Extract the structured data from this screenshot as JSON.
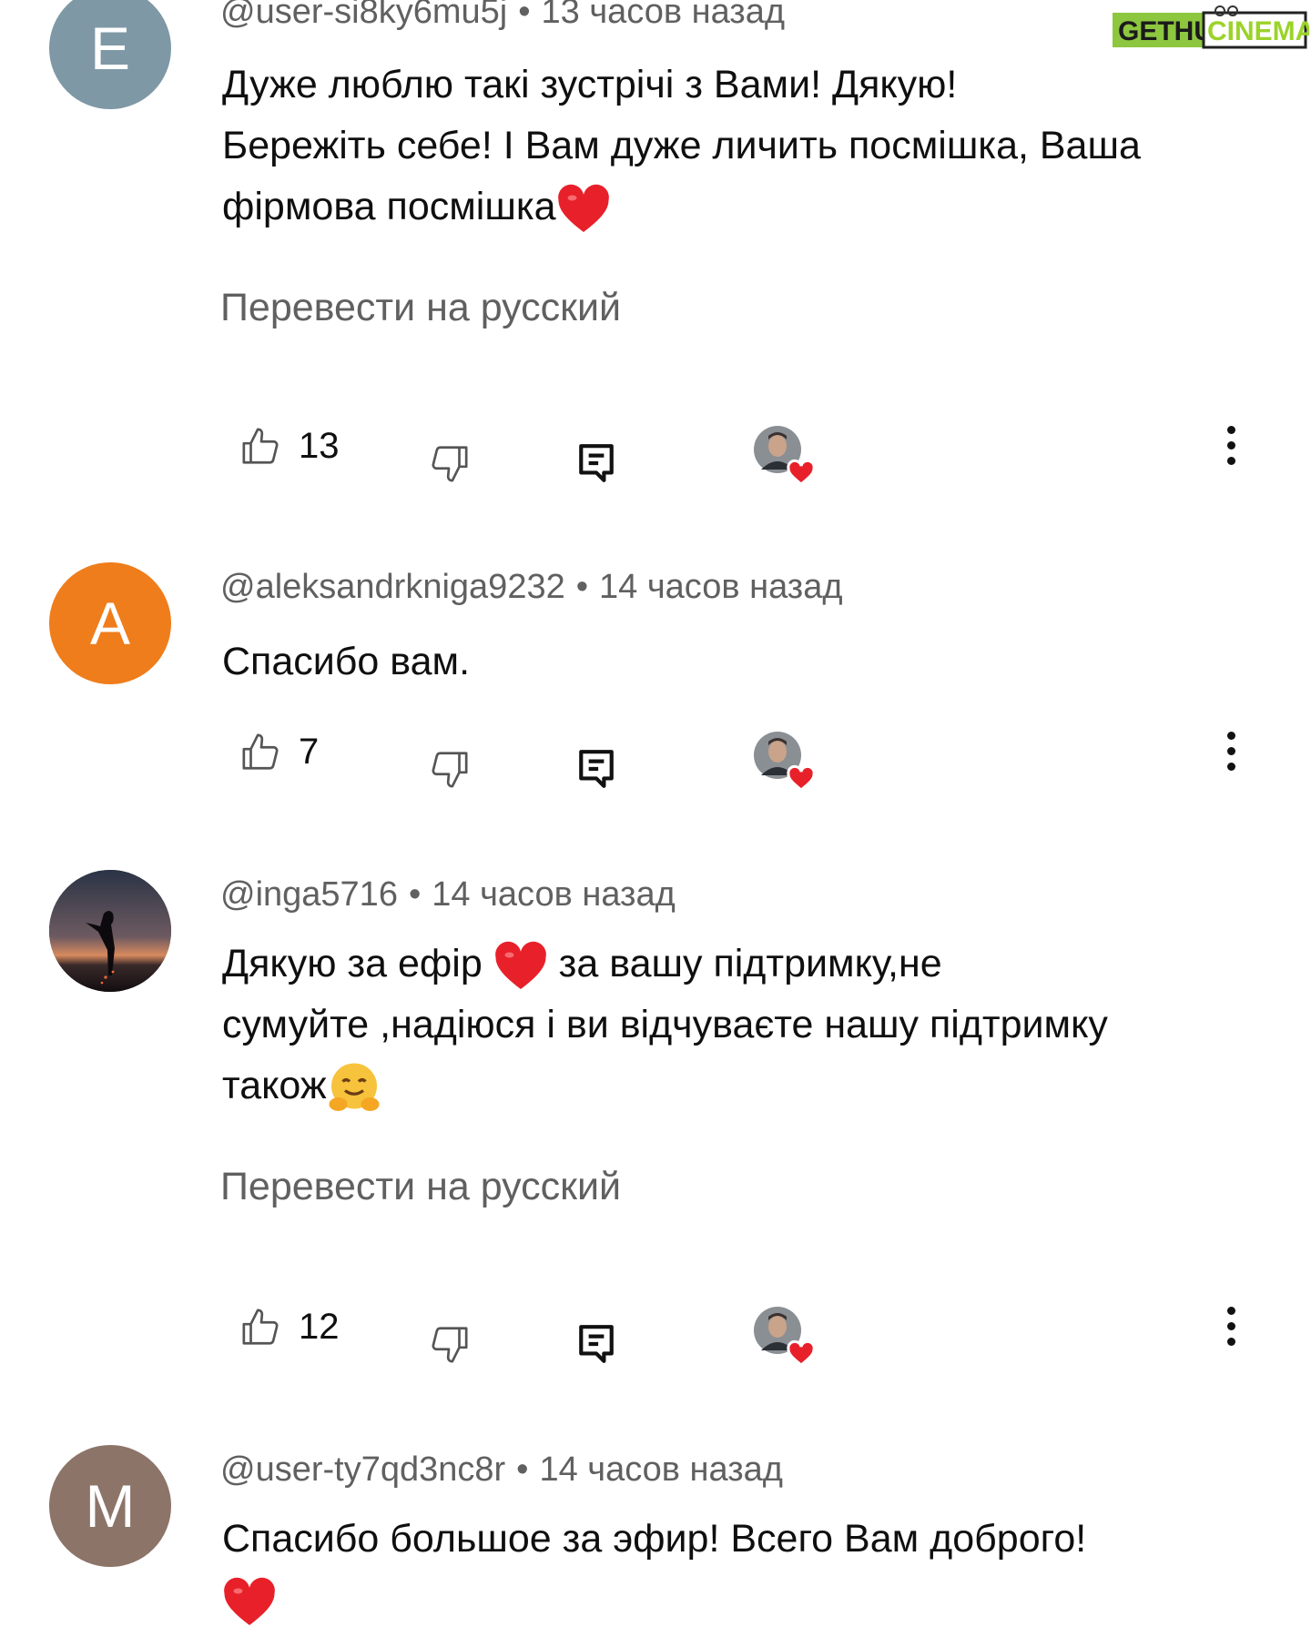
{
  "watermark": {
    "part1": "GETHU",
    "part2": "CINEMA"
  },
  "comments": [
    {
      "avatar_letter": "E",
      "avatar_color": "#7f98a6",
      "username": "@user-si8ky6mu5j",
      "time": "13 часов назад",
      "lines": [
        "Дуже люблю такі зустрічі з Вами! Дякую!",
        "Бережіть себе! І Вам дуже личить посмішка, Ваша",
        "фірмова посмішка"
      ],
      "translate": "Перевести на русский",
      "likes": "13"
    },
    {
      "avatar_letter": "A",
      "avatar_color": "#ef7d1b",
      "username": "@aleksandrkniga9232",
      "time": "14 часов назад",
      "lines": [
        "Спасибо вам."
      ],
      "likes": "7"
    },
    {
      "avatar_letter": "",
      "username": "@inga5716",
      "time": "14 часов назад",
      "lines": [
        "Дякую за ефір",
        "за вашу підтримку,не",
        "сумуйте ,надіюся і ви відчуваєте нашу підтримку",
        "також"
      ],
      "translate": "Перевести на русский",
      "likes": "12"
    },
    {
      "avatar_letter": "M",
      "avatar_color": "#8c7468",
      "username": "@user-ty7qd3nc8r",
      "time": "14 часов назад",
      "lines": [
        "Спасибо большое за эфир! Всего Вам доброго!"
      ]
    }
  ],
  "separator": "•",
  "colors": {
    "meta_text": "#606060",
    "heart": "#e8202a",
    "watermark_green": "#9bd32a"
  }
}
